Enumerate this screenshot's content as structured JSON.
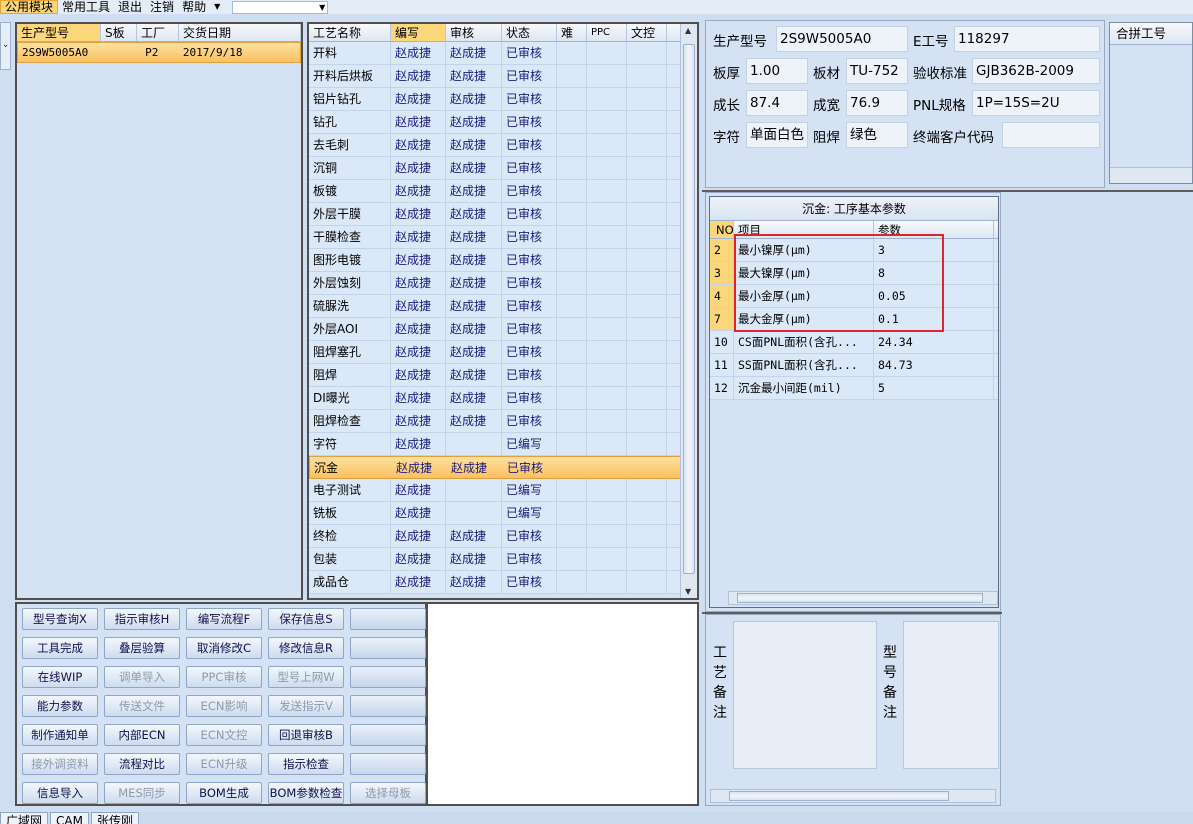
{
  "menu": [
    "公用模块",
    "常用工具",
    "退出",
    "注销",
    "帮助"
  ],
  "order_grid": {
    "headers": [
      "生产型号",
      "S板",
      "工厂",
      "交货日期"
    ],
    "rows": [
      [
        "2S9W5005A0",
        "",
        "P2",
        "2017/9/18"
      ]
    ]
  },
  "process_grid": {
    "headers": [
      "工艺名称",
      "编写",
      "审核",
      "状态",
      "难",
      "PPC",
      "文控"
    ],
    "rows": [
      [
        "开料",
        "赵成捷",
        "赵成捷",
        "已审核"
      ],
      [
        "开料后烘板",
        "赵成捷",
        "赵成捷",
        "已审核"
      ],
      [
        "铝片钻孔",
        "赵成捷",
        "赵成捷",
        "已审核"
      ],
      [
        "钻孔",
        "赵成捷",
        "赵成捷",
        "已审核"
      ],
      [
        "去毛刺",
        "赵成捷",
        "赵成捷",
        "已审核"
      ],
      [
        "沉铜",
        "赵成捷",
        "赵成捷",
        "已审核"
      ],
      [
        "板镀",
        "赵成捷",
        "赵成捷",
        "已审核"
      ],
      [
        "外层干膜",
        "赵成捷",
        "赵成捷",
        "已审核"
      ],
      [
        "干膜检查",
        "赵成捷",
        "赵成捷",
        "已审核"
      ],
      [
        "图形电镀",
        "赵成捷",
        "赵成捷",
        "已审核"
      ],
      [
        "外层蚀刻",
        "赵成捷",
        "赵成捷",
        "已审核"
      ],
      [
        "硫脲洗",
        "赵成捷",
        "赵成捷",
        "已审核"
      ],
      [
        "外层AOI",
        "赵成捷",
        "赵成捷",
        "已审核"
      ],
      [
        "阻焊塞孔",
        "赵成捷",
        "赵成捷",
        "已审核"
      ],
      [
        "阻焊",
        "赵成捷",
        "赵成捷",
        "已审核"
      ],
      [
        "DI曝光",
        "赵成捷",
        "赵成捷",
        "已审核"
      ],
      [
        "阻焊检查",
        "赵成捷",
        "赵成捷",
        "已审核"
      ],
      [
        "字符",
        "赵成捷",
        "",
        "已编写"
      ],
      [
        "沉金",
        "赵成捷",
        "赵成捷",
        "已审核"
      ],
      [
        "电子测试",
        "赵成捷",
        "",
        "已编写"
      ],
      [
        "铣板",
        "赵成捷",
        "",
        "已编写"
      ],
      [
        "终检",
        "赵成捷",
        "赵成捷",
        "已审核"
      ],
      [
        "包装",
        "赵成捷",
        "赵成捷",
        "已审核"
      ],
      [
        "成品仓",
        "赵成捷",
        "赵成捷",
        "已审核"
      ]
    ]
  },
  "buttons": [
    [
      "型号查询X",
      "指示审核H",
      "编写流程F",
      "保存信息S",
      ""
    ],
    [
      "工具完成",
      "叠层验算",
      "取消修改C",
      "修改信息R",
      ""
    ],
    [
      "在线WIP",
      "调单导入",
      "PPC审核",
      "型号上网W",
      ""
    ],
    [
      "能力参数",
      "传送文件",
      "ECN影响",
      "发送指示V",
      ""
    ],
    [
      "制作通知单",
      "内部ECN",
      "ECN文控",
      "回退审核B",
      ""
    ],
    [
      "接外调资料",
      "流程对比",
      "ECN升级",
      "指示检查",
      ""
    ],
    [
      "信息导入",
      "MES同步",
      "BOM生成",
      "BOM参数检查",
      "选择母板"
    ]
  ],
  "info": {
    "model_label": "生产型号",
    "model_value": "2S9W5005A0",
    "e_label": "E工号",
    "e_value": "118297",
    "thick_label": "板厚",
    "thick_value": "1.00",
    "material_label": "板材",
    "material_value": "TU-752",
    "std_label": "验收标准",
    "std_value": "GJB362B-2009",
    "len_label": "成长",
    "len_value": "87.4",
    "width_label": "成宽",
    "width_value": "76.9",
    "pnl_label": "PNL规格",
    "pnl_value": "1P=15S=2U",
    "char_label": "字符",
    "char_value": "单面白色",
    "mask_label": "阻焊",
    "mask_value": "绿色",
    "customer_label": "终端客户代码",
    "customer_value": "",
    "hepin_label": "合拼工号"
  },
  "params": {
    "title": "沉金: 工序基本参数",
    "headers": [
      "NO",
      "项目",
      "参数"
    ],
    "rows": [
      [
        "2",
        "最小镍厚(μm)",
        "3"
      ],
      [
        "3",
        "最大镍厚(μm)",
        "8"
      ],
      [
        "4",
        "最小金厚(μm)",
        "0.05"
      ],
      [
        "7",
        "最大金厚(μm)",
        "0.1"
      ],
      [
        "10",
        "CS面PNL面积(含孔...",
        "24.34"
      ],
      [
        "11",
        "SS面PNL面积(含孔...",
        "84.73"
      ],
      [
        "12",
        "沉金最小间距(mil)",
        "5"
      ]
    ]
  },
  "remarks": {
    "process_label": "工艺备注",
    "model_label": "型号备注"
  },
  "status": [
    "广域网",
    "CAM",
    "张传刚"
  ]
}
